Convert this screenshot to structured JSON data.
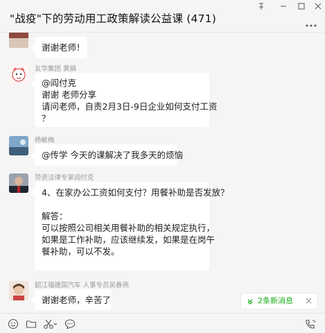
{
  "window": {
    "title": "\"战疫\"下的劳动用工政策解读公益课 (471)",
    "controls": [
      "pin-icon",
      "minimize-icon",
      "maximize-icon",
      "close-icon"
    ],
    "more_icon": "more-icon"
  },
  "messages": [
    {
      "sender": "",
      "lines": [
        "谢谢老师！"
      ]
    },
    {
      "sender": "友华集团 黄娟",
      "lines": [
        "@阎付克",
        "谢谢 老师分享",
        "请问老师，自责2月3日-9日企业如何支付工资",
        "？"
      ]
    },
    {
      "sender": "杨敏梅",
      "lines": [
        "@传学 今天的课解决了我多天的烦恼"
      ]
    },
    {
      "sender": "劳资法律专家阎付克",
      "lines": [
        "4、在家办公工资如何支付？用餐补助是否发放？",
        "",
        "解答：",
        "可以按照公司相关用餐补助的相关规定执行，",
        "如果是工作补助，应该继续发，如果是在岗午",
        "餐补助，可以不发。"
      ]
    },
    {
      "sender": "韶江福建国汽车 人事专员吴春燕",
      "lines": [
        "谢谢老师，辛苦了"
      ]
    }
  ],
  "new_messages": {
    "label": "2条新消息"
  },
  "toolbar": {
    "left_tools": [
      "emoji-icon",
      "folder-icon",
      "scissors-icon",
      "chat-history-icon"
    ],
    "right_tools": [
      "voice-call-icon"
    ]
  },
  "colors": {
    "background": "#f5f5f5",
    "bubble": "#ffffff",
    "accent_green": "#1aad19",
    "sender_gray": "#9b9b9b"
  }
}
